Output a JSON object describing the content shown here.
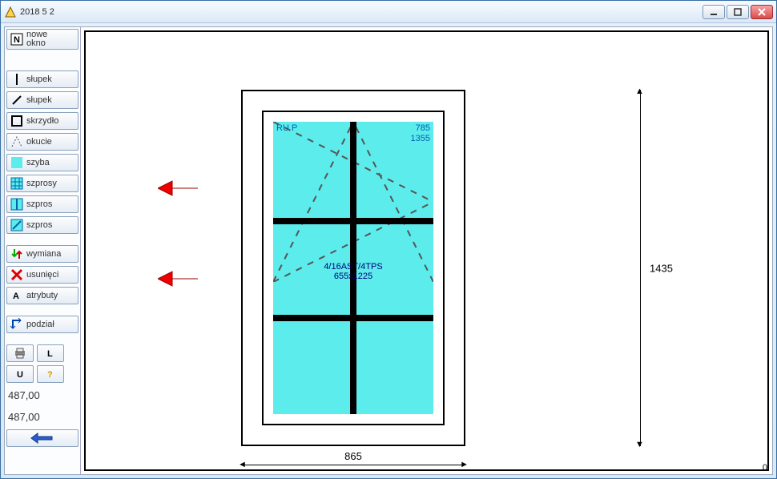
{
  "title": "2018    5    2",
  "buttons": {
    "nowe_okno": "nowe\nokno",
    "slupek1": "słupek",
    "slupek2": "słupek",
    "skrzydlo": "skrzydło",
    "okucie": "okucie",
    "szyba": "szyba",
    "szprosy": "szprosy",
    "szpros1": "szpros",
    "szpros2": "szpros",
    "wymiana": "wymiana",
    "usuniecie": "usunięci",
    "atrybuty": "atrybuty",
    "podzial": "podział"
  },
  "prices": {
    "p1": "487,00",
    "p2": "487,00"
  },
  "model": {
    "sash_type": "RU P",
    "glass_w": "785",
    "glass_h": "1355",
    "glass_spec": "4/16AST/4TPS",
    "glass_dims": "655x1225",
    "dim_w": "865",
    "dim_h": "1435",
    "corner": "0"
  }
}
